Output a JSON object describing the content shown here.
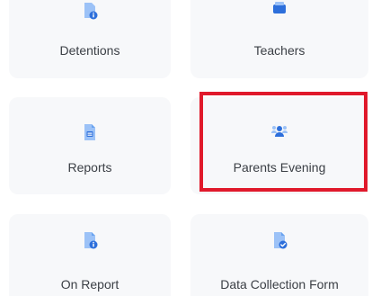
{
  "accent_color": "#3b82f6",
  "highlight_color": "#e0192b",
  "tiles": [
    {
      "label": "Detentions",
      "icon": "document-info-icon"
    },
    {
      "label": "Teachers",
      "icon": "teacher-icon"
    },
    {
      "label": "Reports",
      "icon": "report-document-icon"
    },
    {
      "label": "Parents Evening",
      "icon": "people-group-icon",
      "highlighted": true
    },
    {
      "label": "On Report",
      "icon": "document-info-icon"
    },
    {
      "label": "Data Collection Form",
      "icon": "document-check-icon"
    }
  ]
}
